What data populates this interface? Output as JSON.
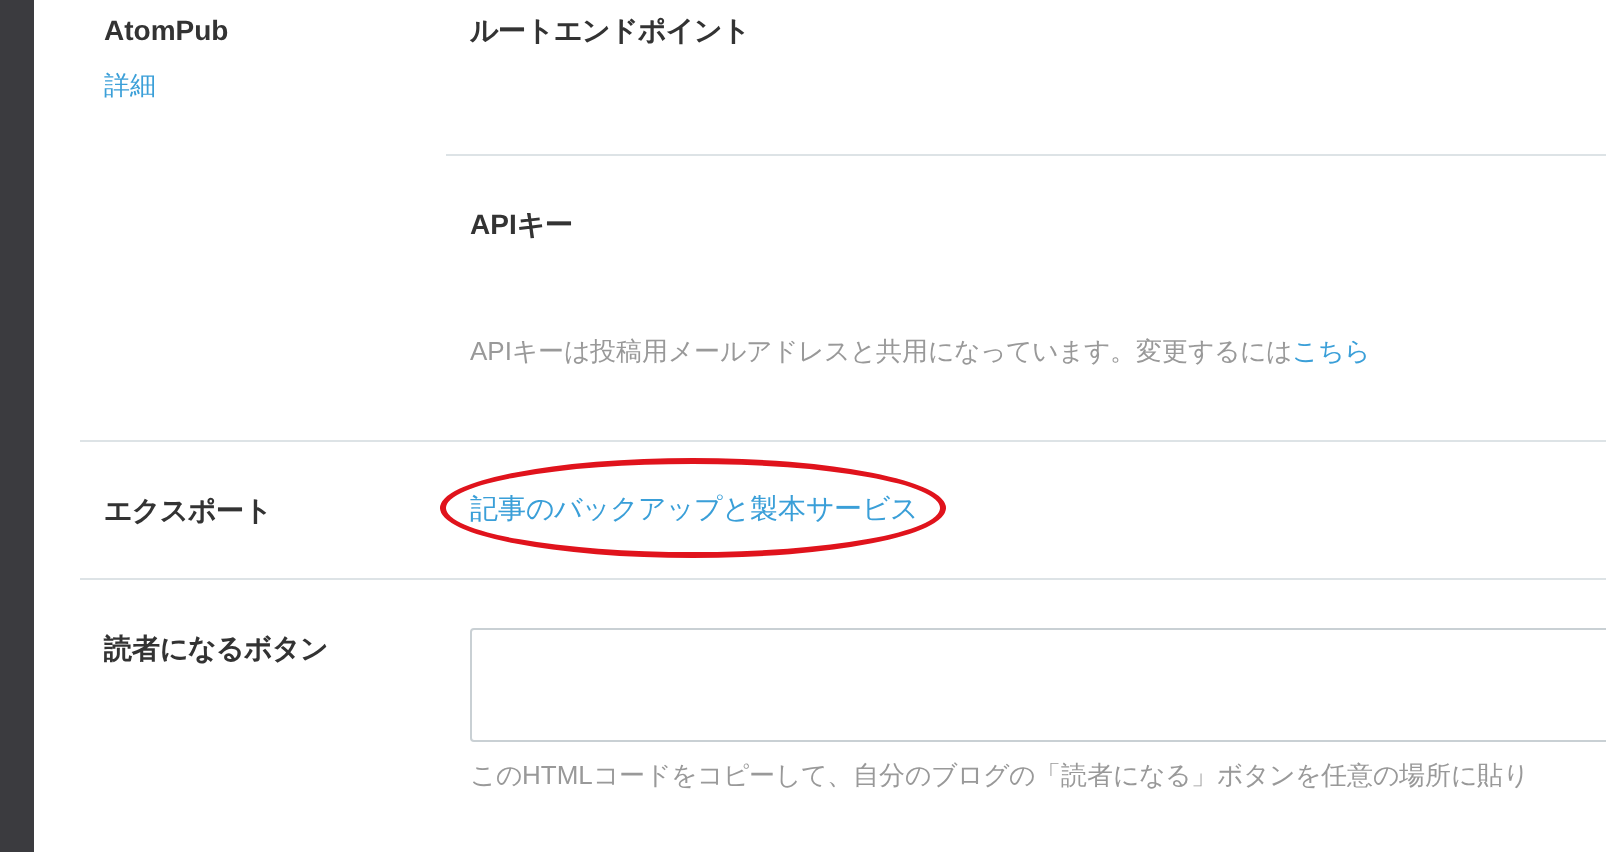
{
  "sections": [
    {
      "kind": "atompub",
      "label": "AtomPub",
      "link": "詳細",
      "fields": [
        {
          "title": "ルートエンドポイント"
        },
        {
          "title": "APIキー",
          "hint": "APIキーは投稿用メールアドレスと共用になっています。変更するには",
          "hint_link": "こちら"
        }
      ]
    },
    {
      "kind": "link",
      "label": "エクスポート",
      "link": "記事のバックアップと製本サービス",
      "highlighted": true
    },
    {
      "kind": "textarea",
      "label": "読者になるボタン",
      "hint": "このHTMLコードをコピーして、自分のブログの「読者になる」ボタンを任意の場所に貼り"
    }
  ]
}
